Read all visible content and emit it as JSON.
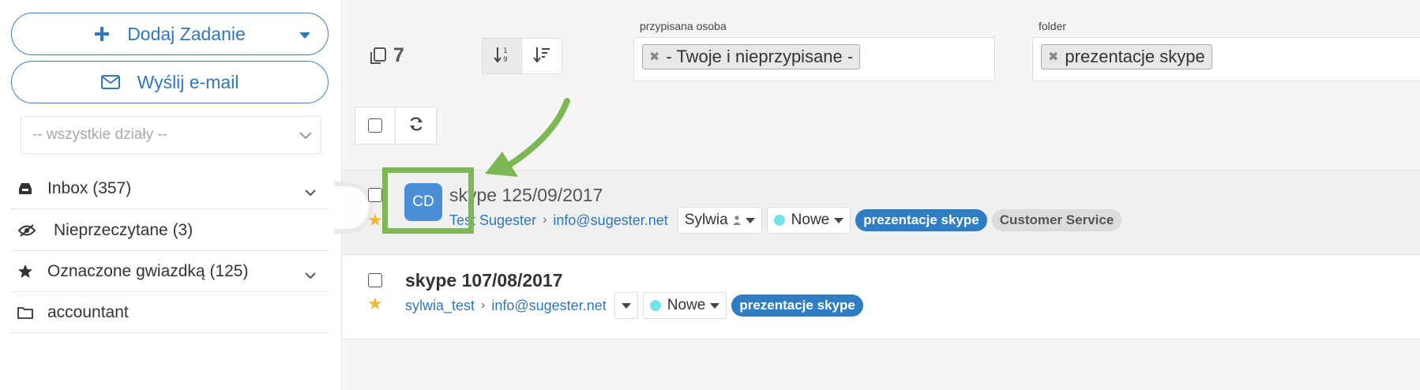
{
  "sidebar": {
    "add_task_label": "Dodaj Zadanie",
    "send_email_label": "Wyślij e-mail",
    "department_placeholder": "-- wszystkie działy --",
    "items": [
      {
        "label": "Inbox (357)",
        "icon": "inbox-icon",
        "expandable": true
      },
      {
        "label": "Nieprzeczytane (3)",
        "icon": "eye-slash-icon",
        "expandable": false
      },
      {
        "label": "Oznaczone gwiazdką (125)",
        "icon": "star-icon",
        "expandable": true
      },
      {
        "label": "accountant",
        "icon": "folder-icon",
        "expandable": false
      }
    ]
  },
  "toolbar": {
    "count": "7",
    "filters": {
      "assigned_label": "przypisana osoba",
      "assigned_value": "- Twoje i nieprzypisane -",
      "folder_label": "folder",
      "folder_value": "prezentacje skype"
    }
  },
  "messages": [
    {
      "initials": "CD",
      "subject": "skype 125/09/2017",
      "from": "Test Sugester",
      "email": "info@sugester.net",
      "assignee": "Sylwia",
      "status": "Nowe",
      "tags": [
        "prezentacje skype",
        "Customer Service"
      ],
      "starred": true
    },
    {
      "subject": "skype 107/08/2017",
      "from": "sylwia_test",
      "email": "info@sugester.net",
      "status": "Nowe",
      "tags": [
        "prezentacje skype"
      ],
      "starred": true
    }
  ],
  "colors": {
    "accent": "#2f77bd",
    "highlight": "#7db854",
    "status_dot": "#6fe3e8",
    "star": "#f2b632"
  }
}
